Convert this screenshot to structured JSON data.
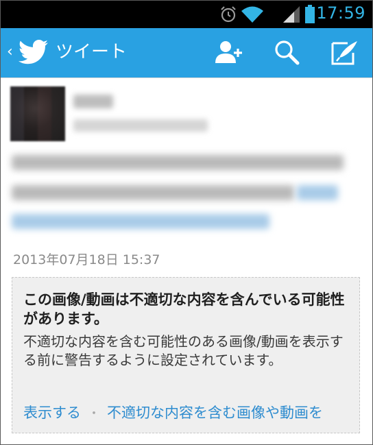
{
  "status_bar": {
    "time": "17:59",
    "icons": [
      "alarm-icon",
      "wifi-icon",
      "signal-icon",
      "battery-icon"
    ],
    "accent": "#33b5e5"
  },
  "action_bar": {
    "title": "ツイート",
    "back_glyph": "‹",
    "background": "#29a1e2",
    "actions": [
      "add-user-icon",
      "search-icon",
      "compose-icon"
    ]
  },
  "tweet": {
    "timestamp": "2013年07月18日 15:37"
  },
  "sensitive_warning": {
    "title": "この画像/動画は不適切な内容を含んでいる可能性があります。",
    "body": "不適切な内容を含む可能性のある画像/動画を表示する前に警告するように設定されています。",
    "show_label": "表示する",
    "separator": "・",
    "settings_label": "不適切な内容を含む画像や動画を",
    "link_color": "#2e8ccf"
  }
}
